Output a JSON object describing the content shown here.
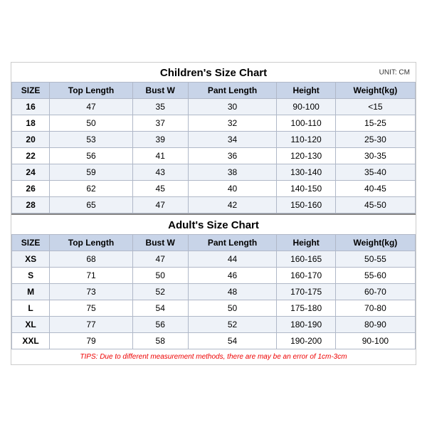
{
  "children_section": {
    "title": "Children's Size Chart",
    "unit": "UNIT: CM",
    "headers": [
      "SIZE",
      "Top Length",
      "Bust W",
      "Pant Length",
      "Height",
      "Weight(kg)"
    ],
    "rows": [
      [
        "16",
        "47",
        "35",
        "30",
        "90-100",
        "<15"
      ],
      [
        "18",
        "50",
        "37",
        "32",
        "100-110",
        "15-25"
      ],
      [
        "20",
        "53",
        "39",
        "34",
        "110-120",
        "25-30"
      ],
      [
        "22",
        "56",
        "41",
        "36",
        "120-130",
        "30-35"
      ],
      [
        "24",
        "59",
        "43",
        "38",
        "130-140",
        "35-40"
      ],
      [
        "26",
        "62",
        "45",
        "40",
        "140-150",
        "40-45"
      ],
      [
        "28",
        "65",
        "47",
        "42",
        "150-160",
        "45-50"
      ]
    ]
  },
  "adults_section": {
    "title": "Adult's Size Chart",
    "headers": [
      "SIZE",
      "Top Length",
      "Bust W",
      "Pant Length",
      "Height",
      "Weight(kg)"
    ],
    "rows": [
      [
        "XS",
        "68",
        "47",
        "44",
        "160-165",
        "50-55"
      ],
      [
        "S",
        "71",
        "50",
        "46",
        "160-170",
        "55-60"
      ],
      [
        "M",
        "73",
        "52",
        "48",
        "170-175",
        "60-70"
      ],
      [
        "L",
        "75",
        "54",
        "50",
        "175-180",
        "70-80"
      ],
      [
        "XL",
        "77",
        "56",
        "52",
        "180-190",
        "80-90"
      ],
      [
        "XXL",
        "79",
        "58",
        "54",
        "190-200",
        "90-100"
      ]
    ]
  },
  "tips": "TIPS: Due to different measurement methods, there are may be an error of 1cm-3cm"
}
